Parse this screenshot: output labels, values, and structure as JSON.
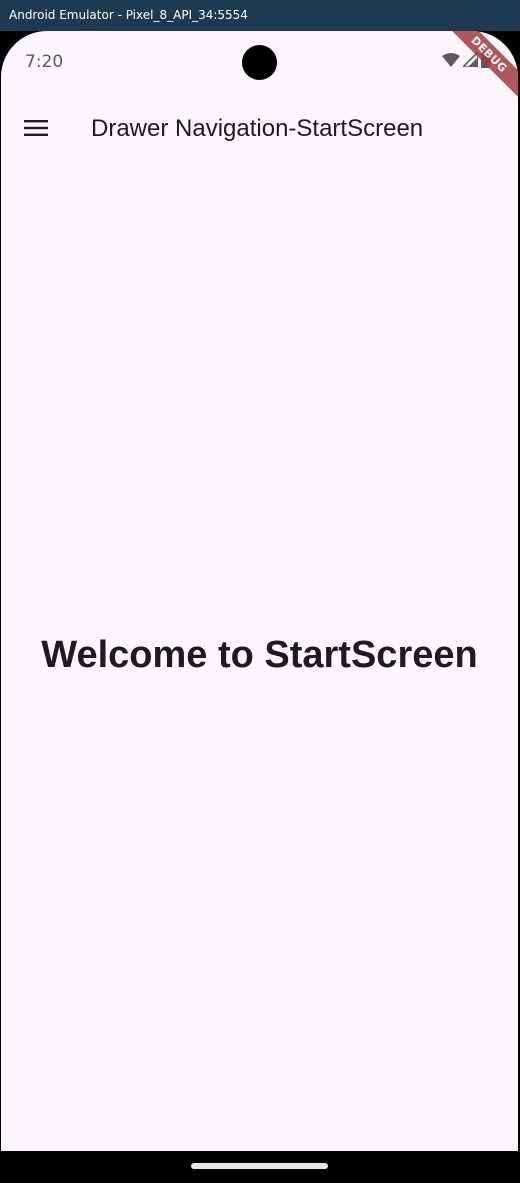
{
  "window": {
    "title": "Android Emulator - Pixel_8_API_34:5554"
  },
  "status_bar": {
    "time": "7:20",
    "icons": [
      "wifi-icon",
      "signal-icon",
      "battery-icon"
    ],
    "debug_banner": "DEBUG"
  },
  "app_bar": {
    "menu_icon": "menu-icon",
    "title": "Drawer Navigation-StartScreen"
  },
  "body": {
    "welcome_text": "Welcome to StartScreen"
  },
  "colors": {
    "window_chrome": "#1e3a50",
    "app_background": "#fdf6fd",
    "text_primary": "#1d1b20",
    "debug_ribbon": "#a33b3f"
  }
}
